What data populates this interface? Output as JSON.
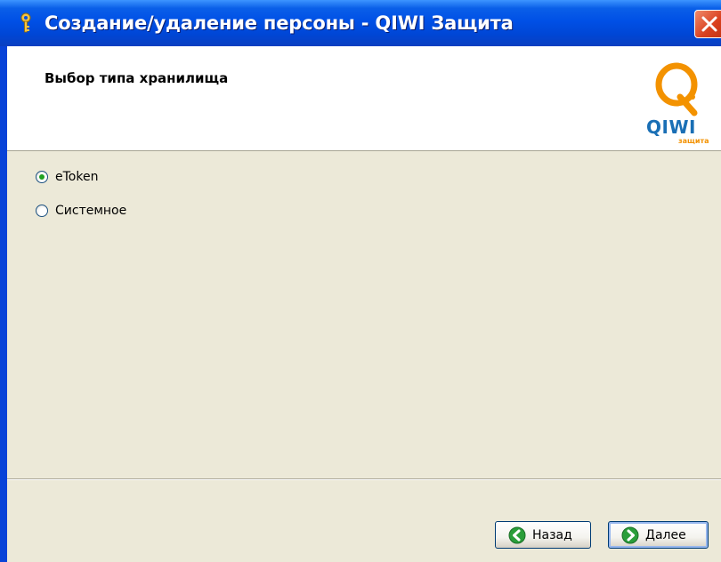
{
  "window": {
    "title": "Создание/удаление персоны - QIWI Защита",
    "icon": "key-icon",
    "close_icon": "close-icon"
  },
  "header": {
    "title": "Выбор типа хранилища",
    "logo_text": "QIWI",
    "logo_subtext": "защита"
  },
  "storage_options": [
    {
      "label": "eToken",
      "selected": true
    },
    {
      "label": "Системное",
      "selected": false
    }
  ],
  "buttons": {
    "back_label": "Назад",
    "next_label": "Далее"
  },
  "colors": {
    "titlebar": "#0050e6",
    "client_bg": "#ece9d8",
    "logo_orange": "#f39200",
    "logo_blue": "#1a6fb5",
    "button_arrow": "#2a9e3a",
    "close_red": "#d9401e"
  }
}
